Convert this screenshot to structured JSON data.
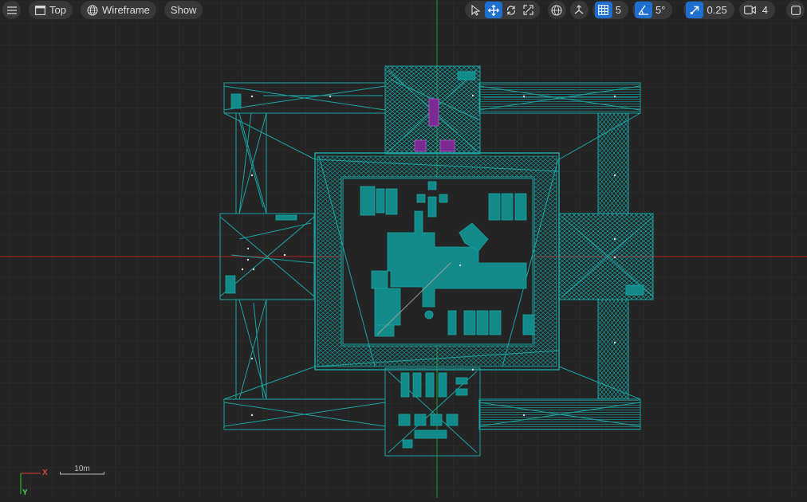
{
  "toolbar": {
    "view_label": "Top",
    "mode_label": "Wireframe",
    "show_label": "Show",
    "grid_snap_value": "5",
    "rotation_snap_value": "5°",
    "scale_snap_value": "0.25",
    "camera_speed_value": "4"
  },
  "legend": {
    "x_label": "X",
    "y_label": "Y"
  },
  "scale_bar": {
    "label": "10m"
  },
  "colors": {
    "background": "#242424",
    "grid": "#2f2f2f",
    "wire": "#1aa3a3",
    "fill": "#138a8a",
    "x_axis": "#b01818",
    "y_axis": "#1e9a1e",
    "highlight": "#9b3bb0",
    "accent": "#1f6fd1"
  }
}
